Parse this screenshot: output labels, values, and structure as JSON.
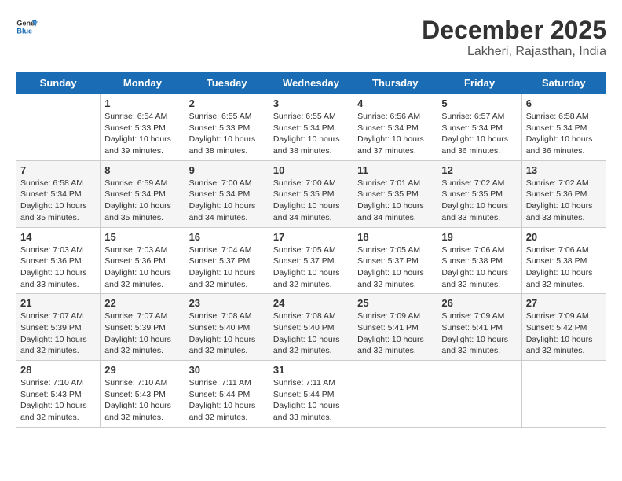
{
  "header": {
    "logo_general": "General",
    "logo_blue": "Blue",
    "month": "December 2025",
    "location": "Lakheri, Rajasthan, India"
  },
  "days_of_week": [
    "Sunday",
    "Monday",
    "Tuesday",
    "Wednesday",
    "Thursday",
    "Friday",
    "Saturday"
  ],
  "weeks": [
    [
      {
        "day": "",
        "info": ""
      },
      {
        "day": "1",
        "info": "Sunrise: 6:54 AM\nSunset: 5:33 PM\nDaylight: 10 hours\nand 39 minutes."
      },
      {
        "day": "2",
        "info": "Sunrise: 6:55 AM\nSunset: 5:33 PM\nDaylight: 10 hours\nand 38 minutes."
      },
      {
        "day": "3",
        "info": "Sunrise: 6:55 AM\nSunset: 5:34 PM\nDaylight: 10 hours\nand 38 minutes."
      },
      {
        "day": "4",
        "info": "Sunrise: 6:56 AM\nSunset: 5:34 PM\nDaylight: 10 hours\nand 37 minutes."
      },
      {
        "day": "5",
        "info": "Sunrise: 6:57 AM\nSunset: 5:34 PM\nDaylight: 10 hours\nand 36 minutes."
      },
      {
        "day": "6",
        "info": "Sunrise: 6:58 AM\nSunset: 5:34 PM\nDaylight: 10 hours\nand 36 minutes."
      }
    ],
    [
      {
        "day": "7",
        "info": "Sunrise: 6:58 AM\nSunset: 5:34 PM\nDaylight: 10 hours\nand 35 minutes."
      },
      {
        "day": "8",
        "info": "Sunrise: 6:59 AM\nSunset: 5:34 PM\nDaylight: 10 hours\nand 35 minutes."
      },
      {
        "day": "9",
        "info": "Sunrise: 7:00 AM\nSunset: 5:34 PM\nDaylight: 10 hours\nand 34 minutes."
      },
      {
        "day": "10",
        "info": "Sunrise: 7:00 AM\nSunset: 5:35 PM\nDaylight: 10 hours\nand 34 minutes."
      },
      {
        "day": "11",
        "info": "Sunrise: 7:01 AM\nSunset: 5:35 PM\nDaylight: 10 hours\nand 34 minutes."
      },
      {
        "day": "12",
        "info": "Sunrise: 7:02 AM\nSunset: 5:35 PM\nDaylight: 10 hours\nand 33 minutes."
      },
      {
        "day": "13",
        "info": "Sunrise: 7:02 AM\nSunset: 5:36 PM\nDaylight: 10 hours\nand 33 minutes."
      }
    ],
    [
      {
        "day": "14",
        "info": "Sunrise: 7:03 AM\nSunset: 5:36 PM\nDaylight: 10 hours\nand 33 minutes."
      },
      {
        "day": "15",
        "info": "Sunrise: 7:03 AM\nSunset: 5:36 PM\nDaylight: 10 hours\nand 32 minutes."
      },
      {
        "day": "16",
        "info": "Sunrise: 7:04 AM\nSunset: 5:37 PM\nDaylight: 10 hours\nand 32 minutes."
      },
      {
        "day": "17",
        "info": "Sunrise: 7:05 AM\nSunset: 5:37 PM\nDaylight: 10 hours\nand 32 minutes."
      },
      {
        "day": "18",
        "info": "Sunrise: 7:05 AM\nSunset: 5:37 PM\nDaylight: 10 hours\nand 32 minutes."
      },
      {
        "day": "19",
        "info": "Sunrise: 7:06 AM\nSunset: 5:38 PM\nDaylight: 10 hours\nand 32 minutes."
      },
      {
        "day": "20",
        "info": "Sunrise: 7:06 AM\nSunset: 5:38 PM\nDaylight: 10 hours\nand 32 minutes."
      }
    ],
    [
      {
        "day": "21",
        "info": "Sunrise: 7:07 AM\nSunset: 5:39 PM\nDaylight: 10 hours\nand 32 minutes."
      },
      {
        "day": "22",
        "info": "Sunrise: 7:07 AM\nSunset: 5:39 PM\nDaylight: 10 hours\nand 32 minutes."
      },
      {
        "day": "23",
        "info": "Sunrise: 7:08 AM\nSunset: 5:40 PM\nDaylight: 10 hours\nand 32 minutes."
      },
      {
        "day": "24",
        "info": "Sunrise: 7:08 AM\nSunset: 5:40 PM\nDaylight: 10 hours\nand 32 minutes."
      },
      {
        "day": "25",
        "info": "Sunrise: 7:09 AM\nSunset: 5:41 PM\nDaylight: 10 hours\nand 32 minutes."
      },
      {
        "day": "26",
        "info": "Sunrise: 7:09 AM\nSunset: 5:41 PM\nDaylight: 10 hours\nand 32 minutes."
      },
      {
        "day": "27",
        "info": "Sunrise: 7:09 AM\nSunset: 5:42 PM\nDaylight: 10 hours\nand 32 minutes."
      }
    ],
    [
      {
        "day": "28",
        "info": "Sunrise: 7:10 AM\nSunset: 5:43 PM\nDaylight: 10 hours\nand 32 minutes."
      },
      {
        "day": "29",
        "info": "Sunrise: 7:10 AM\nSunset: 5:43 PM\nDaylight: 10 hours\nand 32 minutes."
      },
      {
        "day": "30",
        "info": "Sunrise: 7:11 AM\nSunset: 5:44 PM\nDaylight: 10 hours\nand 32 minutes."
      },
      {
        "day": "31",
        "info": "Sunrise: 7:11 AM\nSunset: 5:44 PM\nDaylight: 10 hours\nand 33 minutes."
      },
      {
        "day": "",
        "info": ""
      },
      {
        "day": "",
        "info": ""
      },
      {
        "day": "",
        "info": ""
      }
    ]
  ]
}
